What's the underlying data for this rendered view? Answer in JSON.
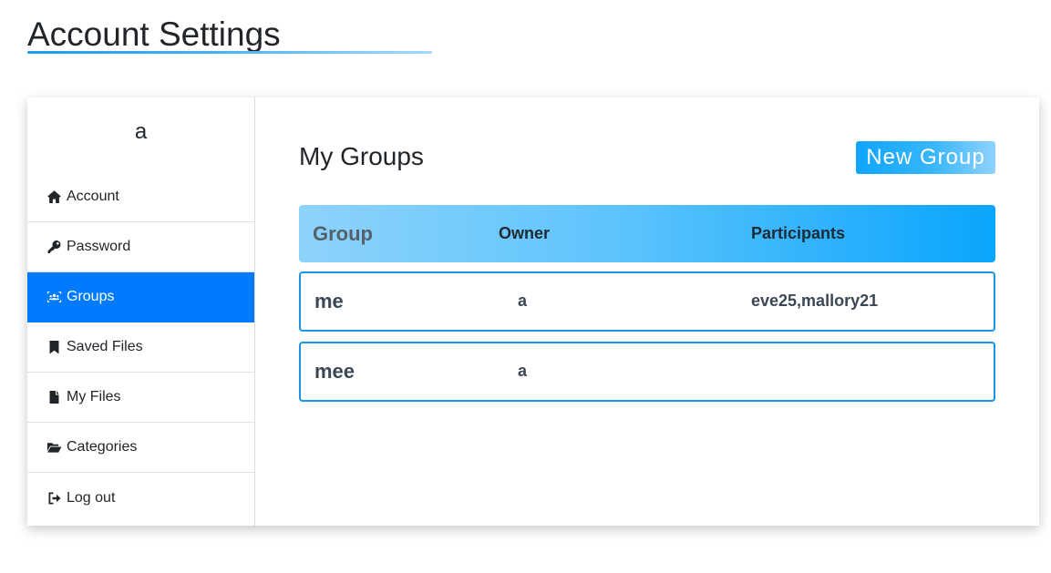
{
  "page": {
    "title": "Account Settings"
  },
  "sidebar": {
    "username": "a",
    "items": [
      {
        "label": "Account",
        "icon": "home-icon"
      },
      {
        "label": "Password",
        "icon": "key-icon"
      },
      {
        "label": "Groups",
        "icon": "users-icon",
        "active": true
      },
      {
        "label": "Saved Files",
        "icon": "bookmark-icon"
      },
      {
        "label": "My Files",
        "icon": "file-icon"
      },
      {
        "label": "Categories",
        "icon": "folder-open-icon"
      },
      {
        "label": "Log out",
        "icon": "sign-out-icon"
      }
    ]
  },
  "main": {
    "title": "My Groups",
    "new_group_label": "New Group",
    "table": {
      "headers": {
        "group": "Group",
        "owner": "Owner",
        "participants": "Participants"
      },
      "rows": [
        {
          "group": "me",
          "owner": "a",
          "participants": "eve25,mallory21"
        },
        {
          "group": "mee",
          "owner": "a",
          "participants": ""
        }
      ]
    }
  },
  "colors": {
    "active_nav": "#007bff",
    "row_border": "#1a94e8",
    "accent_blue": "#0aa5fd"
  }
}
